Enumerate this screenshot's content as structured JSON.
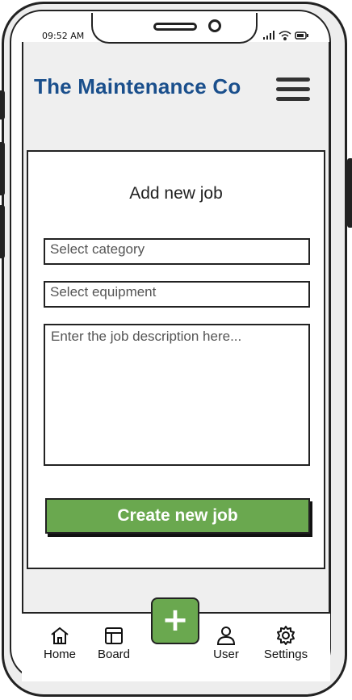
{
  "status_bar": {
    "time": "09:52 AM"
  },
  "header": {
    "title": "The Maintenance Co"
  },
  "form": {
    "title": "Add new job",
    "category_placeholder": "Select category",
    "equipment_placeholder": "Select equipment",
    "description_placeholder": "Enter the job description here...",
    "submit_label": "Create new job"
  },
  "nav": {
    "items": [
      {
        "label": "Home",
        "icon": "home-icon"
      },
      {
        "label": "Board",
        "icon": "board-icon"
      },
      {
        "label": "User",
        "icon": "user-icon"
      },
      {
        "label": "Settings",
        "icon": "gear-icon"
      }
    ],
    "fab_symbol": "+"
  },
  "colors": {
    "brand": "#1a4f8c",
    "accent": "#6aa84f"
  }
}
